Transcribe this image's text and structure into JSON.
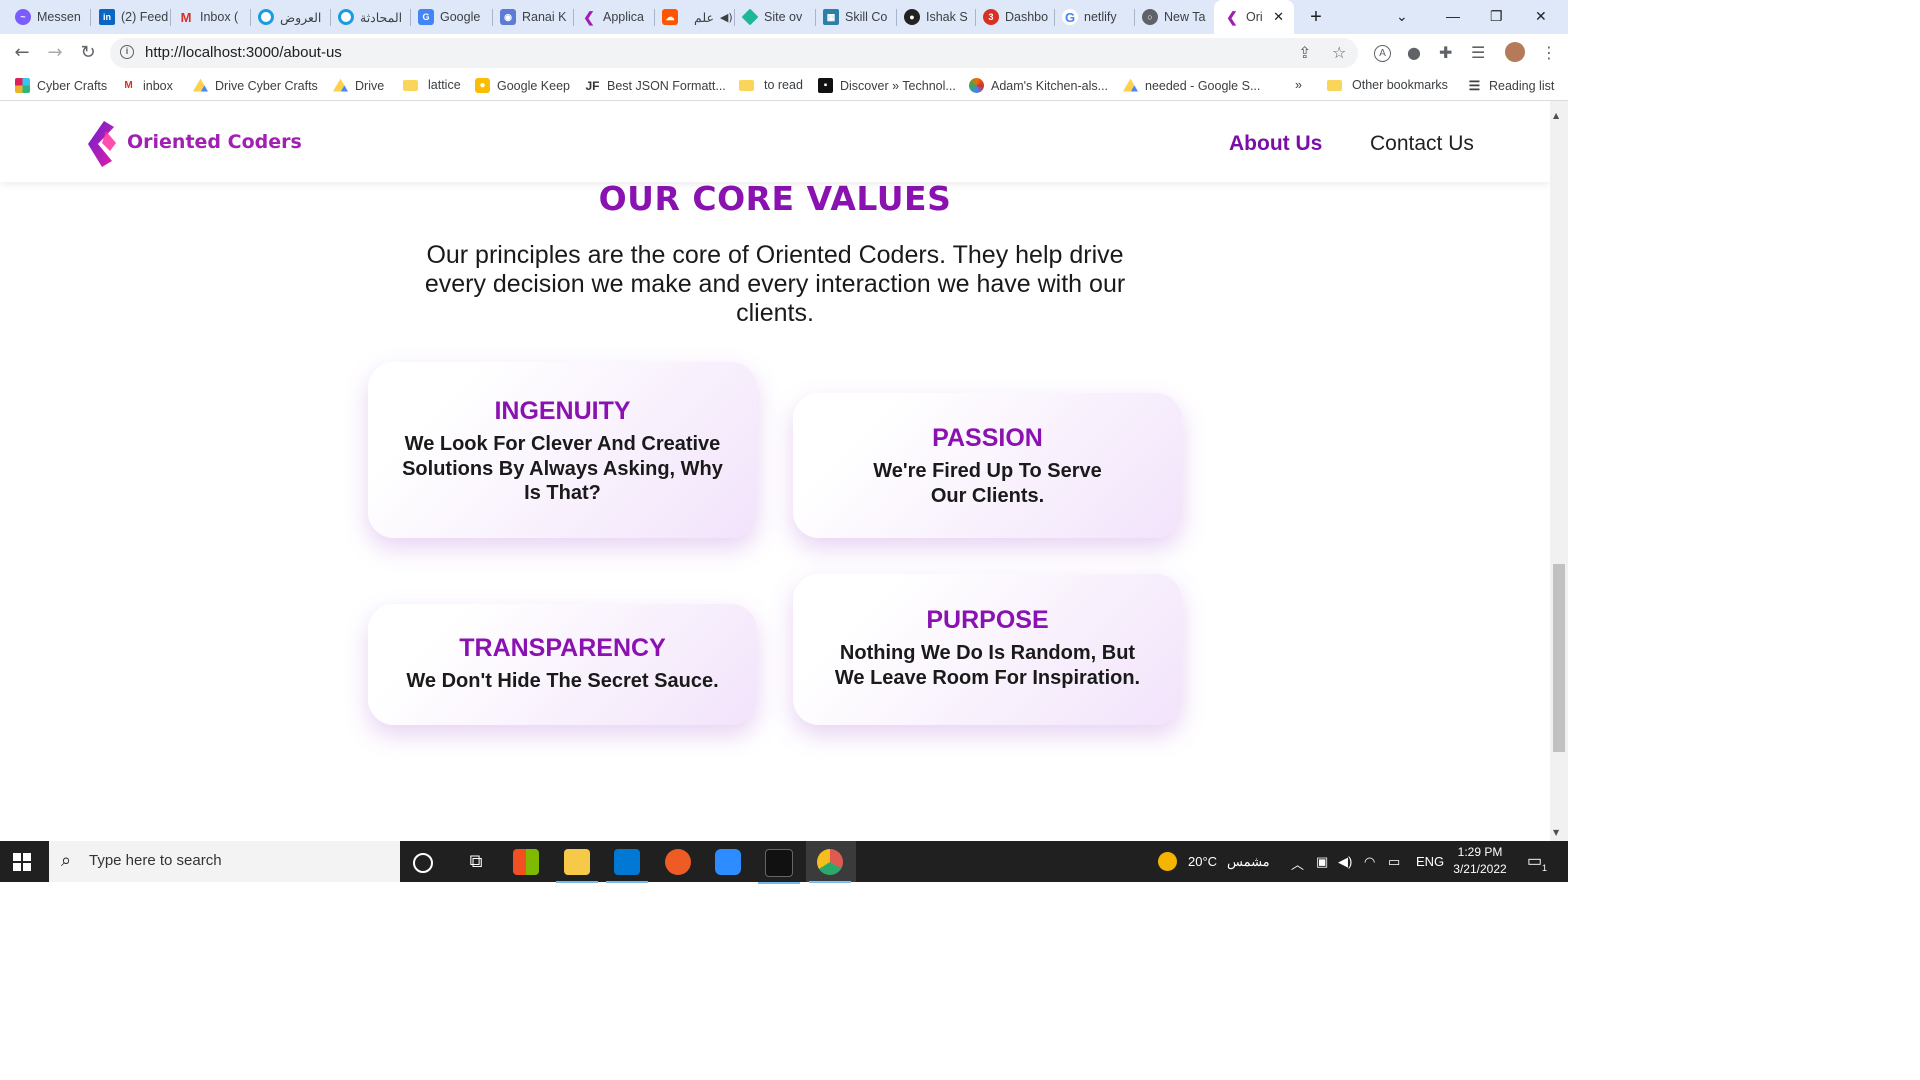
{
  "browser": {
    "tabs": [
      {
        "title": "Messen",
        "icon": "messenger-icon",
        "color": "#7b5cff"
      },
      {
        "title": "(2) Feed",
        "icon": "linkedin-icon",
        "color": "#0a66c2"
      },
      {
        "title": "Inbox (",
        "icon": "gmail-icon",
        "color": "#d93025"
      },
      {
        "title": "العروض",
        "icon": "circle-app-icon",
        "color": "#1a9de0"
      },
      {
        "title": "المحادثة",
        "icon": "circle-app-icon",
        "color": "#1a9de0"
      },
      {
        "title": "Google",
        "icon": "google-translate-icon",
        "color": "#4285f4"
      },
      {
        "title": "Ranai K",
        "icon": "camera-icon",
        "color": "#5b7bd5"
      },
      {
        "title": "Applica",
        "icon": "oriented-coders-icon",
        "color": "#a21fb4"
      },
      {
        "title": "علم",
        "icon": "soundcloud-icon",
        "color": "#ff5500"
      },
      {
        "title": "Site ov",
        "icon": "netlify-icon",
        "color": "#20b69b"
      },
      {
        "title": "Skill Co",
        "icon": "skill-icon",
        "color": "#2d7fa8"
      },
      {
        "title": "Ishak S",
        "icon": "github-icon",
        "color": "#222222"
      },
      {
        "title": "Dashbo",
        "icon": "dashboard-icon",
        "color": "#d93025"
      },
      {
        "title": "netlify",
        "icon": "google-icon",
        "color": "#4285f4"
      },
      {
        "title": "New Ta",
        "icon": "chrome-icon",
        "color": "#5f6368"
      },
      {
        "title": "Ori",
        "icon": "oriented-coders-icon",
        "color": "#a21fb4"
      }
    ],
    "url": "http://localhost:3000/about-us",
    "bookmarks": [
      {
        "label": "Cyber Crafts",
        "icon": "slack-icon",
        "color": "#e01e5a"
      },
      {
        "label": "inbox",
        "icon": "gmail-icon",
        "color": "#d93025"
      },
      {
        "label": "Drive Cyber Crafts",
        "icon": "drive-icon",
        "color": "#1fa463"
      },
      {
        "label": "Drive",
        "icon": "drive-icon",
        "color": "#1fa463"
      },
      {
        "label": "lattice",
        "icon": "folder-icon",
        "color": "#f9d65b"
      },
      {
        "label": "Google Keep",
        "icon": "keep-icon",
        "color": "#fbbc04"
      },
      {
        "label": "Best JSON Formatt...",
        "icon": "jf-icon",
        "color": "#333333"
      },
      {
        "label": "to read",
        "icon": "folder-icon",
        "color": "#f9d65b"
      },
      {
        "label": "Discover » Technol...",
        "icon": "discover-icon",
        "color": "#111111"
      },
      {
        "label": "Adam's Kitchen-als...",
        "icon": "circle-color-icon",
        "color": "#e8710a"
      },
      {
        "label": "needed - Google S...",
        "icon": "drive-icon",
        "color": "#1fa463"
      }
    ],
    "bookmarks_overflow": "»",
    "other_bookmarks": "Other bookmarks",
    "reading_list": "Reading list"
  },
  "site": {
    "logo_text": "Oriented Coders",
    "nav": {
      "about": "About Us",
      "contact": "Contact Us"
    },
    "brand_color": "#8a12b0"
  },
  "values_section": {
    "title": "OUR CORE VALUES",
    "subtitle": "Our principles are the core of Oriented Coders. They help drive every decision we make and every interaction we have with our clients.",
    "cards": [
      {
        "title": "INGENUITY",
        "desc": "We Look For Clever And Creative Solutions By Always Asking, Why Is That?"
      },
      {
        "title": "PASSION",
        "desc": "We're Fired Up To Serve Our Clients."
      },
      {
        "title": "TRANSPARENCY",
        "desc": "We Don't Hide The Secret Sauce."
      },
      {
        "title": "PURPOSE",
        "desc": "Nothing We Do Is Random, But We Leave Room For Inspiration."
      }
    ]
  },
  "taskbar": {
    "search_placeholder": "Type here to search",
    "weather": "20°C",
    "weather_desc": "مشمس",
    "language": "ENG",
    "time": "1:29 PM",
    "date": "3/21/2022",
    "notification_count": "1"
  }
}
